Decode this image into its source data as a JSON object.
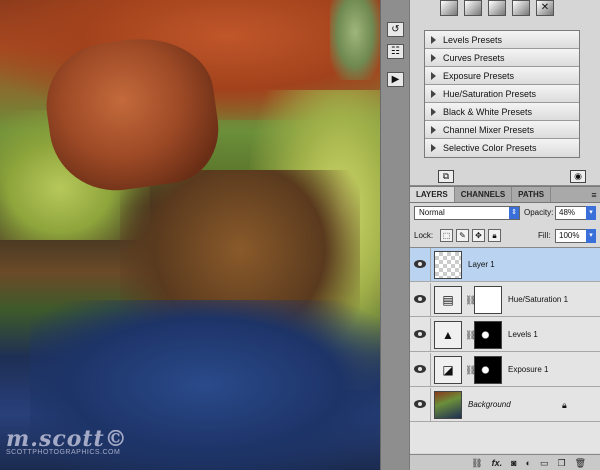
{
  "watermark": {
    "signature": "m.scott©",
    "site": "SCOTTPHOTOGRAPHICS.COM"
  },
  "adjustments": {
    "presets": [
      "Levels Presets",
      "Curves Presets",
      "Exposure Presets",
      "Hue/Saturation Presets",
      "Black & White Presets",
      "Channel Mixer Presets",
      "Selective Color Presets"
    ]
  },
  "layers_panel": {
    "tabs": [
      "LAYERS",
      "CHANNELS",
      "PATHS"
    ],
    "active_tab": "LAYERS",
    "blend_mode": "Normal",
    "opacity_label": "Opacity:",
    "opacity_value": "48%",
    "lock_label": "Lock:",
    "fill_label": "Fill:",
    "fill_value": "100%",
    "layers": [
      {
        "name": "Layer 1",
        "selected": true
      },
      {
        "name": "Hue/Saturation 1",
        "selected": false
      },
      {
        "name": "Levels 1",
        "selected": false
      },
      {
        "name": "Exposure 1",
        "selected": false
      },
      {
        "name": "Background",
        "selected": false,
        "locked": true
      }
    ],
    "bottom_icons": [
      "link-layers-icon",
      "fx-icon",
      "mask-icon",
      "adjustment-icon",
      "folder-icon",
      "new-layer-icon",
      "trash-icon"
    ],
    "fx_label": "fx."
  },
  "colors": {
    "accent": "#3a6ed8",
    "selected_row": "#b9d3f0",
    "panel_bg": "#d9d9d9"
  }
}
